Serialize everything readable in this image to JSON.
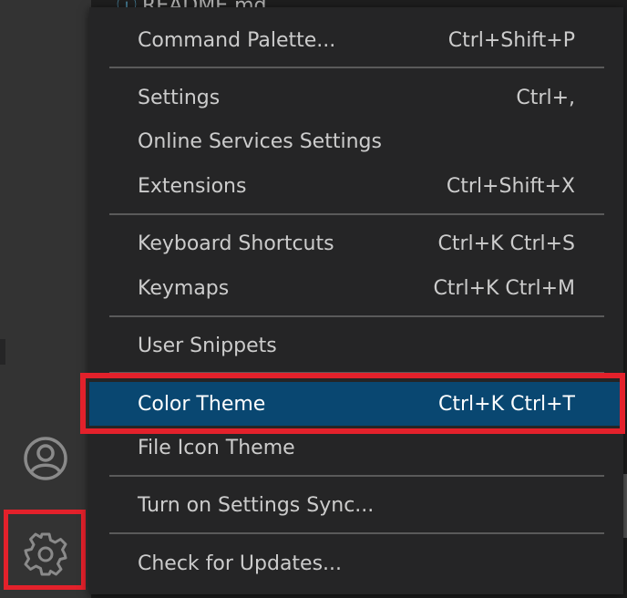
{
  "background": {
    "file_tab_label": "README.md"
  },
  "activity_bar": {
    "account_icon": "account-icon",
    "manage_icon": "gear-icon"
  },
  "menu": {
    "items": [
      {
        "label": "Command Palette...",
        "shortcut": "Ctrl+Shift+P"
      },
      {
        "label": "Settings",
        "shortcut": "Ctrl+,"
      },
      {
        "label": "Online Services Settings",
        "shortcut": ""
      },
      {
        "label": "Extensions",
        "shortcut": "Ctrl+Shift+X"
      },
      {
        "label": "Keyboard Shortcuts",
        "shortcut": "Ctrl+K Ctrl+S"
      },
      {
        "label": "Keymaps",
        "shortcut": "Ctrl+K Ctrl+M"
      },
      {
        "label": "User Snippets",
        "shortcut": ""
      },
      {
        "label": "Color Theme",
        "shortcut": "Ctrl+K Ctrl+T",
        "selected": true
      },
      {
        "label": "File Icon Theme",
        "shortcut": ""
      },
      {
        "label": "Turn on Settings Sync...",
        "shortcut": ""
      },
      {
        "label": "Check for Updates...",
        "shortcut": ""
      }
    ]
  },
  "colors": {
    "selection": "#094771",
    "annotation": "#e3212b",
    "menu_background": "#252526",
    "activity_bar": "#333333"
  }
}
